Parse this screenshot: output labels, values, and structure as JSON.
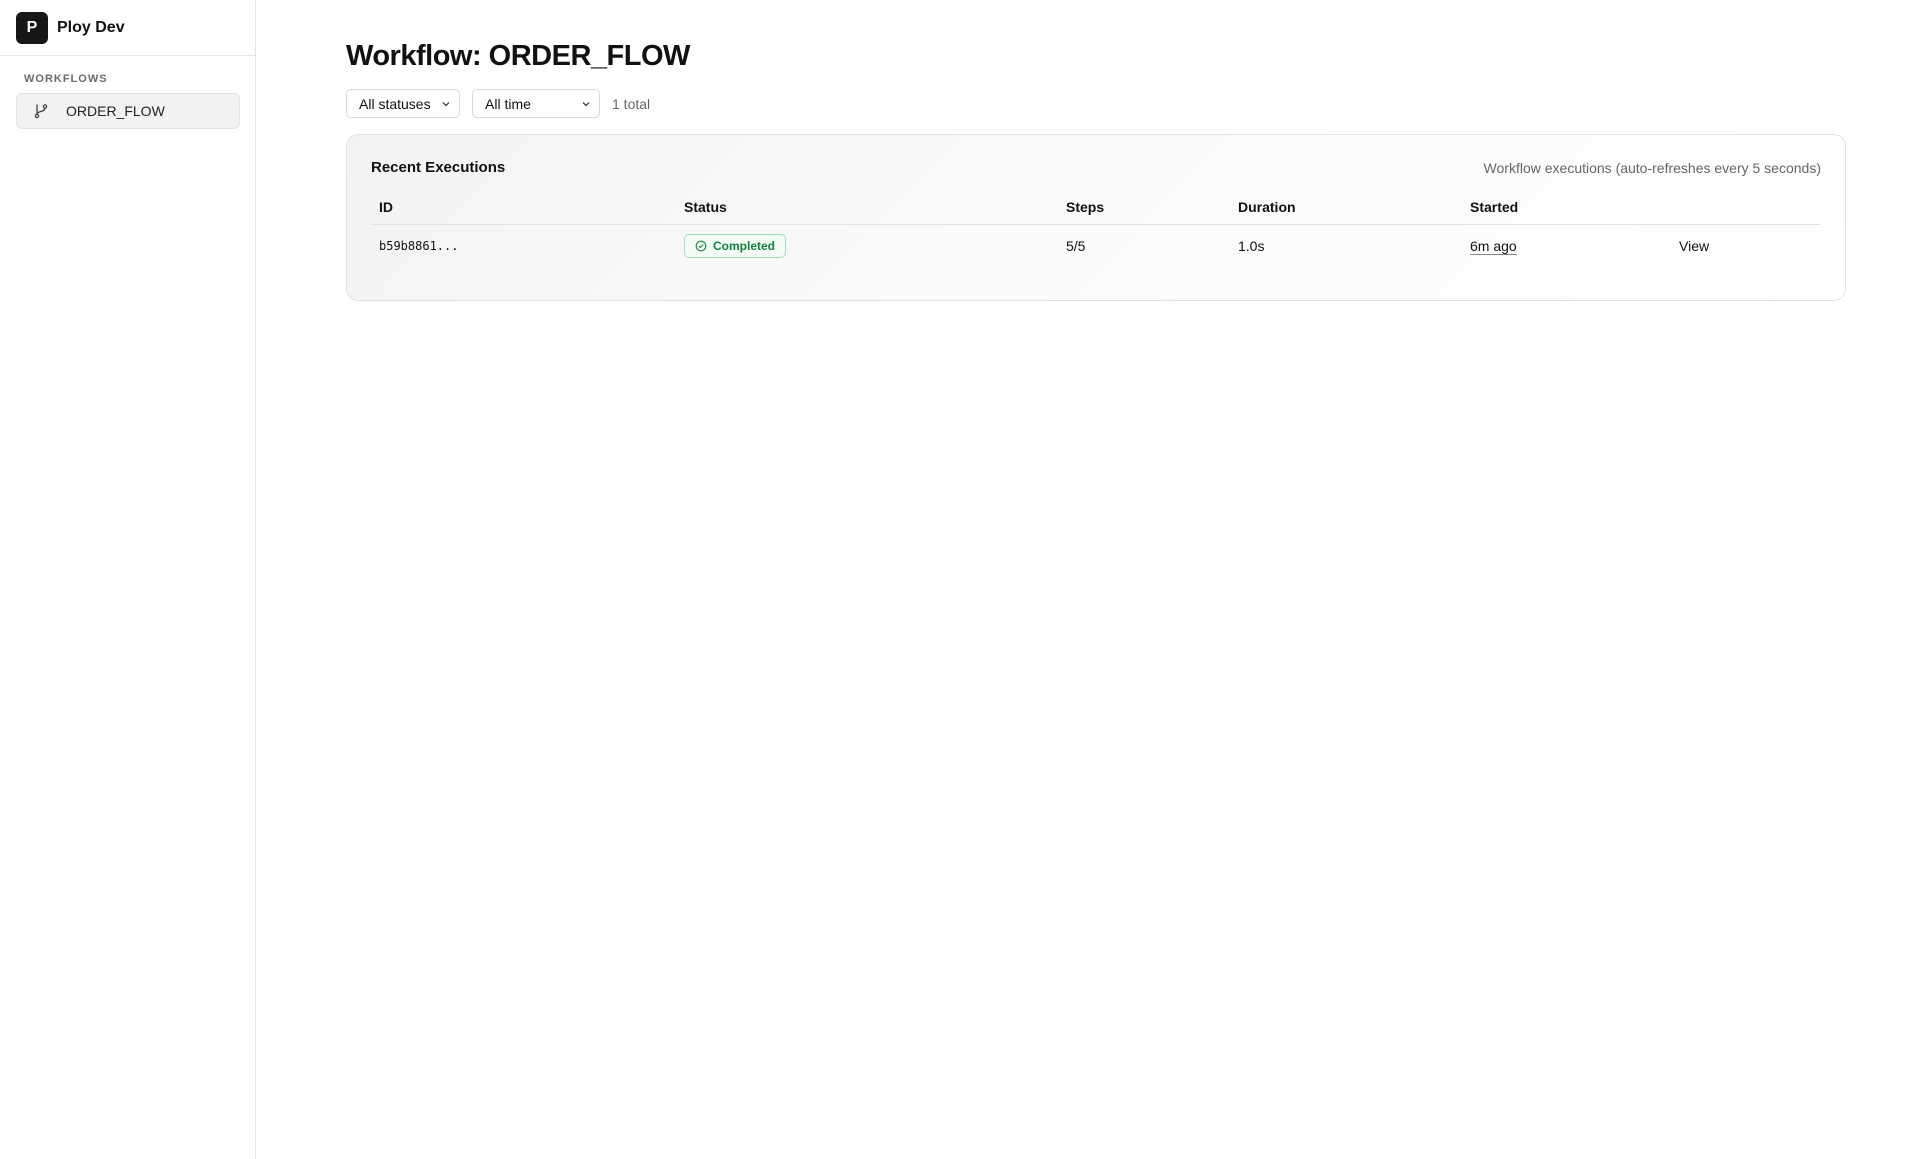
{
  "brand": {
    "logo_letter": "P",
    "name": "Ploy Dev"
  },
  "sidebar": {
    "section_label": "WORKFLOWS",
    "items": [
      {
        "label": "ORDER_FLOW",
        "icon": "git-branch-icon"
      }
    ]
  },
  "page": {
    "title": "Workflow: ORDER_FLOW"
  },
  "filters": {
    "status_selected": "All statuses",
    "time_selected": "All time",
    "total_text": "1 total"
  },
  "executions": {
    "title": "Recent Executions",
    "description": "Workflow executions (auto-refreshes every 5 seconds)",
    "columns": [
      "ID",
      "Status",
      "Steps",
      "Duration",
      "Started",
      ""
    ],
    "rows": [
      {
        "id": "b59b8861...",
        "status": "Completed",
        "steps": "5/5",
        "duration": "1.0s",
        "started": "6m ago",
        "action": "View"
      }
    ]
  },
  "colors": {
    "brand_logo_bg": "#171717",
    "status_completed": "#15803d",
    "status_completed_border": "#9fe0b4"
  }
}
